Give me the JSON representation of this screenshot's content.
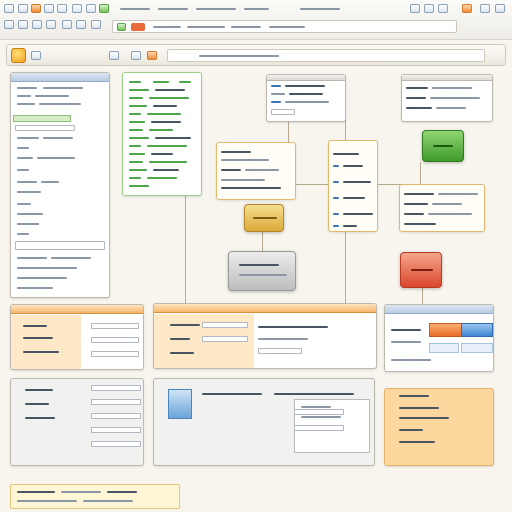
{
  "toolbar": {
    "icons": [
      "file-icon",
      "folder-icon",
      "save-icon",
      "edit-icon",
      "view-icon",
      "tools-icon",
      "settings-icon",
      "help-icon"
    ],
    "right_icons": [
      "back-icon",
      "forward-icon",
      "refresh-icon",
      "user-icon",
      "close-icon"
    ]
  },
  "addressbar": {
    "url_placeholder": ""
  },
  "colors": {
    "accent_orange": "#f08a38",
    "accent_green": "#4aa84a",
    "accent_blue": "#3b73b8",
    "node_green": "#4fae3c",
    "node_red": "#e0503a",
    "node_gold": "#e2b848",
    "node_grey": "#c9c9c9"
  },
  "panels": {
    "left_list": {
      "rows": 18
    },
    "code_panel": {
      "rows": 16
    },
    "bottom_forms": 6
  },
  "caption": {
    "lines": 3
  }
}
